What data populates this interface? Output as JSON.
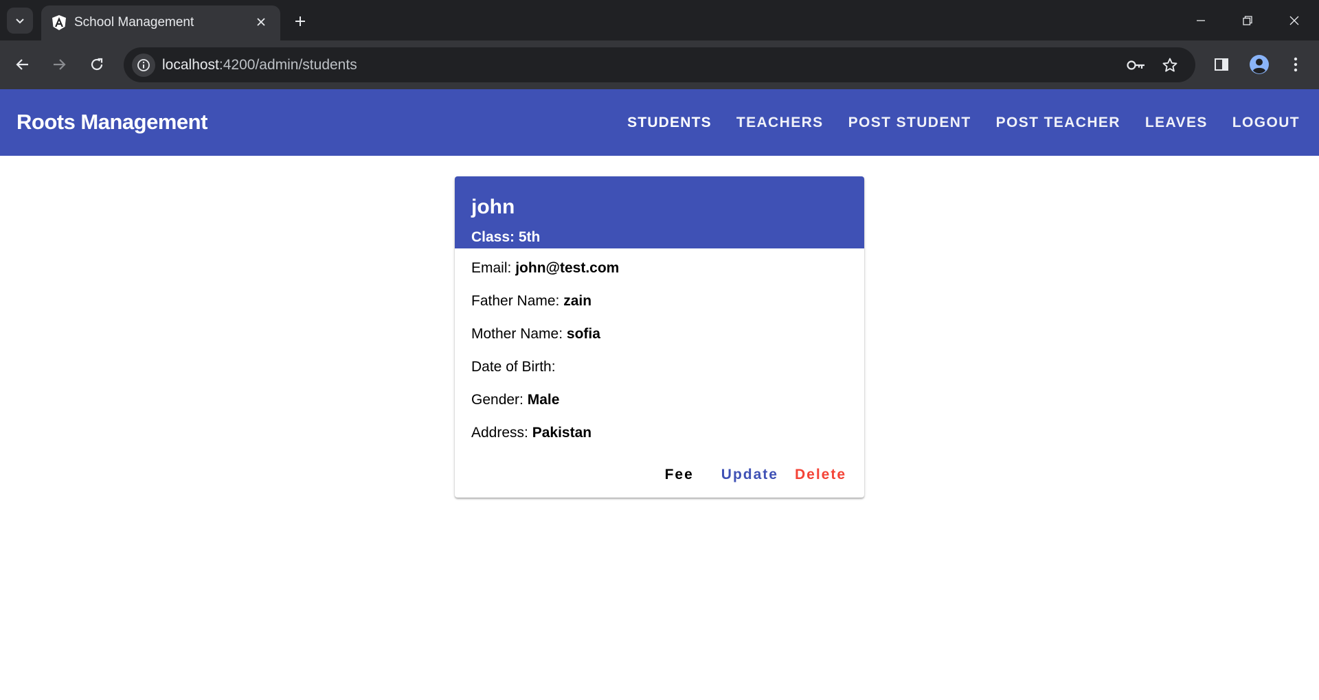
{
  "browser": {
    "tab_title": "School Management",
    "url_host": "localhost",
    "url_rest": ":4200/admin/students",
    "icons": [
      "tab-search-icon",
      "angular-favicon-icon",
      "close-icon",
      "plus-icon",
      "minimize-icon",
      "restore-icon",
      "window-close-icon",
      "back-icon",
      "forward-icon",
      "reload-icon",
      "info-icon",
      "key-icon",
      "star-icon",
      "side-panel-icon",
      "profile-icon",
      "kebab-menu-icon"
    ]
  },
  "app": {
    "brand": "Roots Management",
    "nav": {
      "students": "STUDENTS",
      "teachers": "TEACHERS",
      "post_student": "POST STUDENT",
      "post_teacher": "POST TEACHER",
      "leaves": "LEAVES",
      "logout": "LOGOUT"
    },
    "accent": "#3f51b5",
    "danger": "#f44336"
  },
  "student": {
    "name": "john",
    "class_label": "Class:",
    "class_value": "5th",
    "email_label": "Email:",
    "email_value": "john@test.com",
    "father_label": "Father Name:",
    "father_value": "zain",
    "mother_label": "Mother Name:",
    "mother_value": "sofia",
    "dob_label": "Date of Birth:",
    "dob_value": "",
    "gender_label": "Gender:",
    "gender_value": "Male",
    "address_label": "Address:",
    "address_value": "Pakistan"
  },
  "actions": {
    "fee": "Fee",
    "update": "Update",
    "delete": "Delete"
  }
}
